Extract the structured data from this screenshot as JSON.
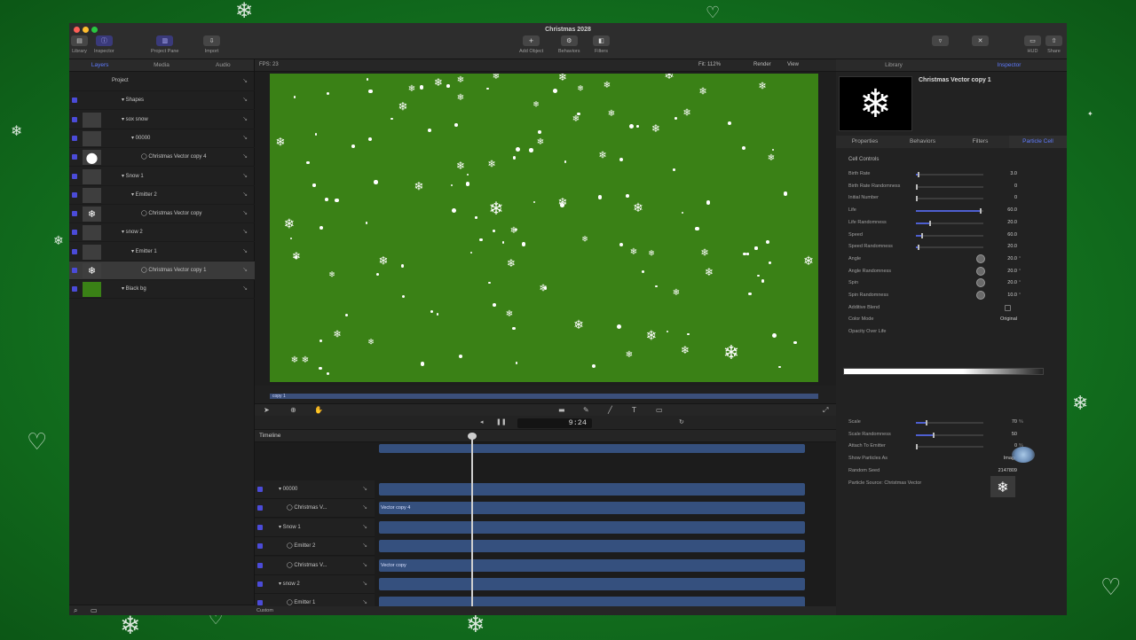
{
  "app": {
    "title": "Christmas 2028",
    "toolbar": {
      "library": "Library",
      "inspector": "Inspector",
      "project_pane": "Project Pane",
      "import": "Import",
      "add_object": "Add Object",
      "behaviors": "Behaviors",
      "filters": "Filters",
      "hud": "HUD",
      "share": "Share"
    }
  },
  "left_panel": {
    "tabs": [
      "Layers",
      "Media",
      "Audio"
    ],
    "active_tab": "Layers",
    "layers": [
      {
        "name": "Project",
        "indent": 0
      },
      {
        "name": "Shapes",
        "indent": 1
      },
      {
        "name": "sox snow",
        "indent": 1
      },
      {
        "name": "00000",
        "indent": 2
      },
      {
        "name": "Christmas Vector copy 4",
        "indent": 3
      },
      {
        "name": "Snow 1",
        "indent": 1
      },
      {
        "name": "Emitter 2",
        "indent": 2
      },
      {
        "name": "Christmas Vector copy",
        "indent": 3
      },
      {
        "name": "snow 2",
        "indent": 1
      },
      {
        "name": "Emitter 1",
        "indent": 2
      },
      {
        "name": "Christmas Vector copy 1",
        "indent": 3
      },
      {
        "name": "Black bg",
        "indent": 1
      }
    ]
  },
  "viewer": {
    "fps": "FPS: 23",
    "fit": "Fit: 112%",
    "render": "Render",
    "view": "View",
    "mini_track_label": "copy 1",
    "timecode": "9:24"
  },
  "timeline": {
    "title": "Timeline",
    "rows": [
      {
        "name": "00000",
        "indent": 1
      },
      {
        "name": "Christmas V...",
        "indent": 2
      },
      {
        "name": "Snow 1",
        "indent": 1
      },
      {
        "name": "Emitter 2",
        "indent": 2
      },
      {
        "name": "Christmas V...",
        "indent": 2
      },
      {
        "name": "snow 2",
        "indent": 1
      },
      {
        "name": "Emitter 1",
        "indent": 2
      },
      {
        "name": "Christmas V...",
        "indent": 2
      }
    ],
    "tracks": [
      "",
      "Vector copy 4",
      "",
      "",
      "Vector copy",
      "",
      "",
      "Vector copy 1"
    ],
    "bottom_label": "Custom"
  },
  "inspector": {
    "tabs": [
      "Library",
      "Inspector"
    ],
    "active_tab": "Inspector",
    "object_name": "Christmas Vector copy 1",
    "sub_tabs": [
      "Properties",
      "Behaviors",
      "Filters",
      "Particle Cell"
    ],
    "active_sub_tab": "Particle Cell",
    "section": "Cell Controls",
    "params": [
      {
        "label": "Birth Rate",
        "value": "3.0",
        "unit": "",
        "kind": "slider",
        "level": 0.02
      },
      {
        "label": "Birth Rate Randomness",
        "value": "0",
        "unit": "",
        "kind": "slider",
        "level": 0.0
      },
      {
        "label": "Initial Number",
        "value": "0",
        "unit": "",
        "kind": "slider",
        "level": 0.0
      },
      {
        "label": "Life",
        "value": "60.0",
        "unit": "",
        "kind": "slider",
        "level": 0.95
      },
      {
        "label": "Life Randomness",
        "value": "20.0",
        "unit": "",
        "kind": "slider",
        "level": 0.2
      },
      {
        "label": "Speed",
        "value": "60.0",
        "unit": "",
        "kind": "slider",
        "level": 0.08
      },
      {
        "label": "Speed Randomness",
        "value": "20.0",
        "unit": "",
        "kind": "slider",
        "level": 0.02
      },
      {
        "label": "Angle",
        "value": "20.0",
        "unit": "°",
        "kind": "dial",
        "level": 0
      },
      {
        "label": "Angle Randomness",
        "value": "20.0",
        "unit": "°",
        "kind": "dial",
        "level": 0
      },
      {
        "label": "Spin",
        "value": "20.0",
        "unit": "°",
        "kind": "dial",
        "level": 0
      },
      {
        "label": "Spin Randomness",
        "value": "10.0",
        "unit": "°",
        "kind": "dial",
        "level": 0
      },
      {
        "label": "Additive Blend",
        "value": "",
        "unit": "",
        "kind": "check",
        "level": 0
      },
      {
        "label": "Color Mode",
        "value": "Original",
        "unit": "",
        "kind": "text",
        "level": 0
      },
      {
        "label": "Opacity Over Life",
        "value": "",
        "unit": "",
        "kind": "text",
        "level": 0
      }
    ],
    "params2": [
      {
        "label": "Scale",
        "value": "70",
        "unit": "%",
        "kind": "slider",
        "level": 0.15
      },
      {
        "label": "Scale Randomness",
        "value": "50",
        "unit": "",
        "kind": "slider",
        "level": 0.25
      },
      {
        "label": "Attach To Emitter",
        "value": "0",
        "unit": "%",
        "kind": "slider",
        "level": 0.0
      },
      {
        "label": "Show Particles As",
        "value": "Image",
        "unit": "",
        "kind": "text",
        "level": 0
      },
      {
        "label": "Random Seed",
        "value": "2147809",
        "unit": "",
        "kind": "text",
        "level": 0
      },
      {
        "label": "Particle Source: Christmas Vector",
        "value": "",
        "unit": "",
        "kind": "text",
        "level": 0
      }
    ]
  },
  "icons": {
    "snowflake": "snowflake-icon",
    "heart": "heart-icon"
  },
  "colors": {
    "canvas_bg": "#3a8116",
    "accent": "#5f7bff",
    "track": "#35507e"
  }
}
